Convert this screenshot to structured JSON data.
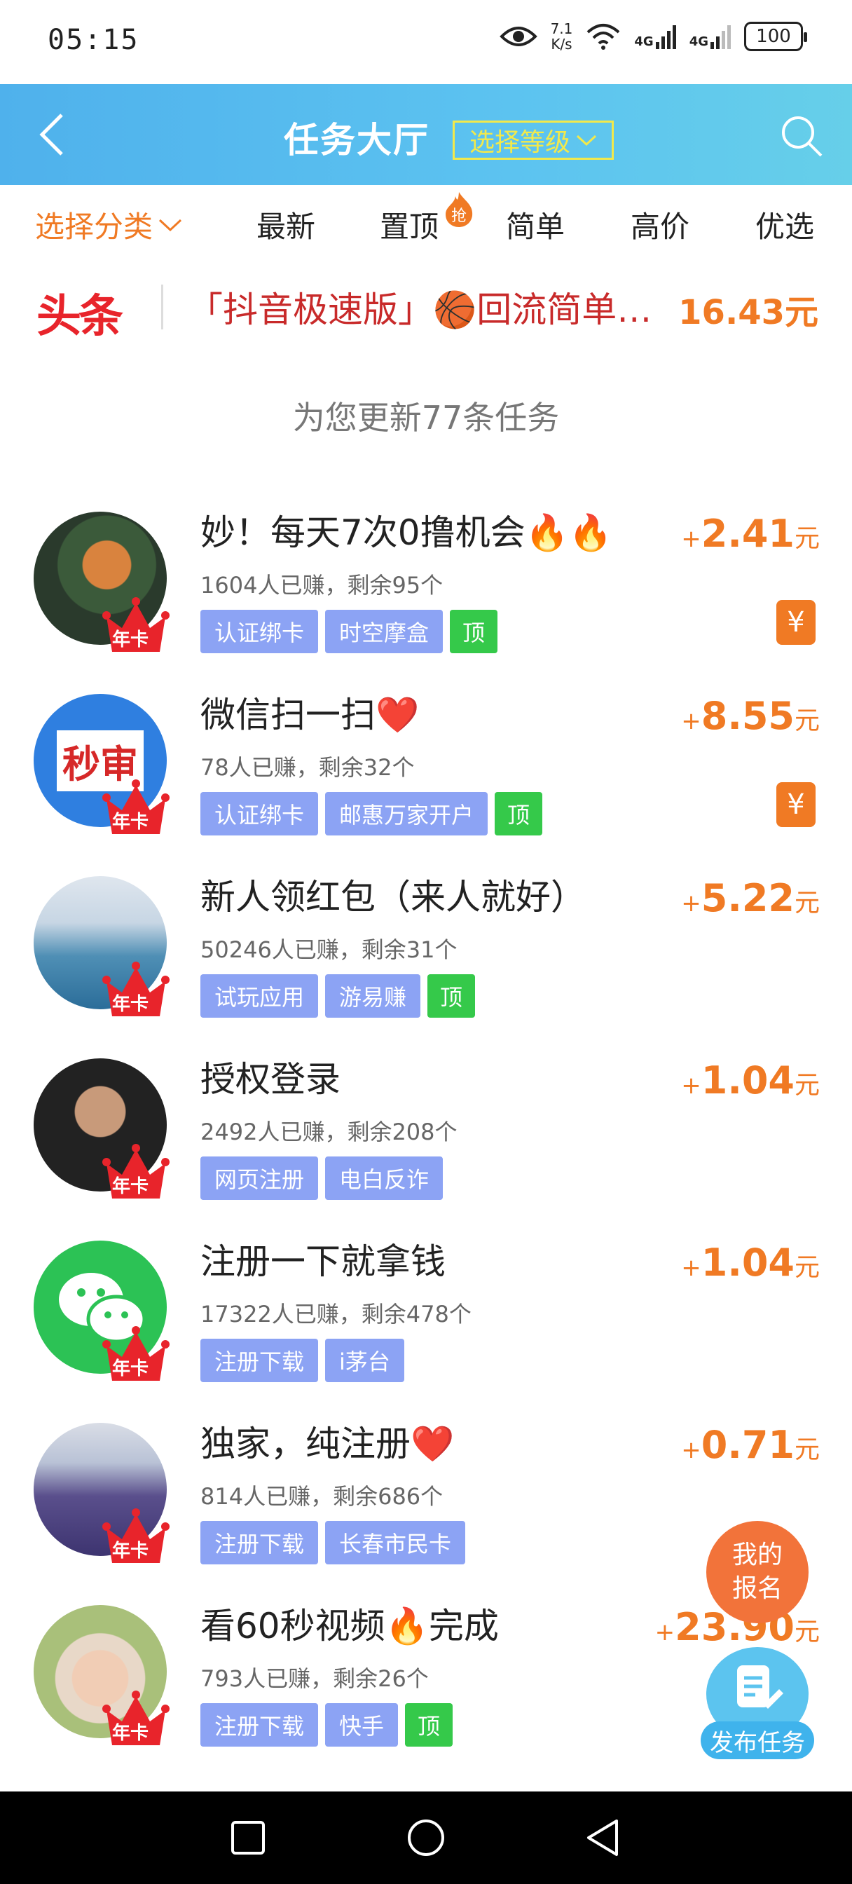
{
  "status_bar": {
    "time": "05:15",
    "net_speed_value": "7.1",
    "net_speed_unit": "K/s",
    "signal1": "4G",
    "signal2": "4G",
    "battery": "100"
  },
  "header": {
    "title": "任务大厅",
    "level_button": "选择等级"
  },
  "filters": {
    "category": "选择分类",
    "items": [
      "最新",
      "置顶",
      "简单",
      "高价",
      "优选"
    ],
    "hot_badge": "抢"
  },
  "ticker": {
    "logo": "头条",
    "text": "「抖音极速版」🏀回流简单…",
    "price": "16.43元"
  },
  "update_note": "为您更新77条任务",
  "tasks": [
    {
      "title": "妙！每天7次0撸机会🔥🔥",
      "meta": "1604人已赚，剩余95个",
      "tags": [
        "认证绑卡",
        "时空摩盒"
      ],
      "top": "顶",
      "price_sign": "+",
      "price": "2.41",
      "unit": "元",
      "coupon": "¥",
      "badge": "年卡"
    },
    {
      "title": "微信扫一扫❤️",
      "meta": "78人已赚，剩余32个",
      "tags": [
        "认证绑卡",
        "邮惠万家开户"
      ],
      "top": "顶",
      "price_sign": "+",
      "price": "8.55",
      "unit": "元",
      "coupon": "¥",
      "badge": "年卡",
      "avatar_text": "秒审"
    },
    {
      "title": "新人领红包（来人就好）",
      "meta": "50246人已赚，剩余31个",
      "tags": [
        "试玩应用",
        "游易赚"
      ],
      "top": "顶",
      "price_sign": "+",
      "price": "5.22",
      "unit": "元",
      "badge": "年卡"
    },
    {
      "title": "授权登录",
      "meta": "2492人已赚，剩余208个",
      "tags": [
        "网页注册",
        "电白反诈"
      ],
      "price_sign": "+",
      "price": "1.04",
      "unit": "元",
      "badge": "年卡"
    },
    {
      "title": "注册一下就拿钱",
      "meta": "17322人已赚，剩余478个",
      "tags": [
        "注册下载",
        "i茅台"
      ],
      "price_sign": "+",
      "price": "1.04",
      "unit": "元",
      "badge": "年卡"
    },
    {
      "title": "独家，纯注册❤️",
      "meta": "814人已赚，剩余686个",
      "tags": [
        "注册下载",
        "长春市民卡"
      ],
      "price_sign": "+",
      "price": "0.71",
      "unit": "元",
      "badge": "年卡"
    },
    {
      "title": "看60秒视频🔥完成",
      "meta": "793人已赚，剩余26个",
      "tags": [
        "注册下载",
        "快手"
      ],
      "top": "顶",
      "price_sign": "+",
      "price": "23.90",
      "unit": "元",
      "badge": "年卡"
    }
  ],
  "fab": {
    "signup_line1": "我的",
    "signup_line2": "报名",
    "publish": "发布任务"
  }
}
